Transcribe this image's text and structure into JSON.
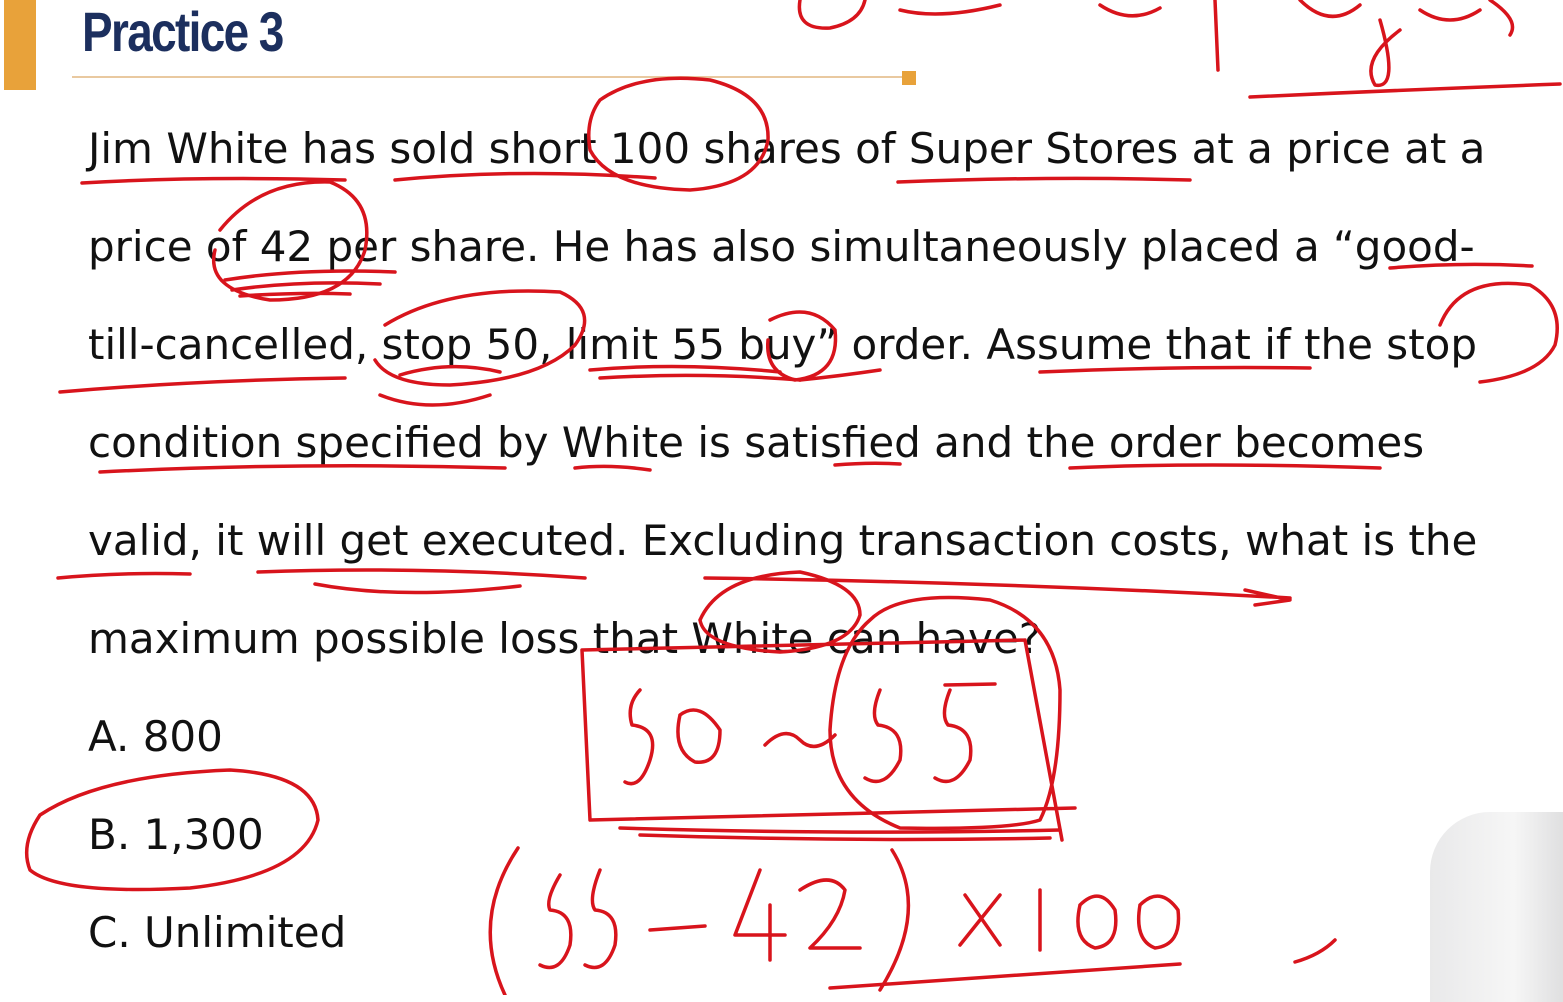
{
  "slide": {
    "title": "Practice 3",
    "question_lines": [
      "Jim White has sold short 100 shares of Super Stores at a price at a",
      "price of 42 per share. He has also simultaneously placed a “good-",
      "till-cancelled, stop 50, limit 55 buy” order. Assume that if the stop",
      "condition specified by White is satisfied and the order becomes",
      "valid, it will get executed. Excluding transaction costs, what is the",
      "maximum possible loss that White can have?"
    ],
    "options": [
      "A. 800",
      "B. 1,300",
      "C. Unlimited"
    ]
  },
  "annotations": {
    "ink_color": "#d8141c"
  }
}
